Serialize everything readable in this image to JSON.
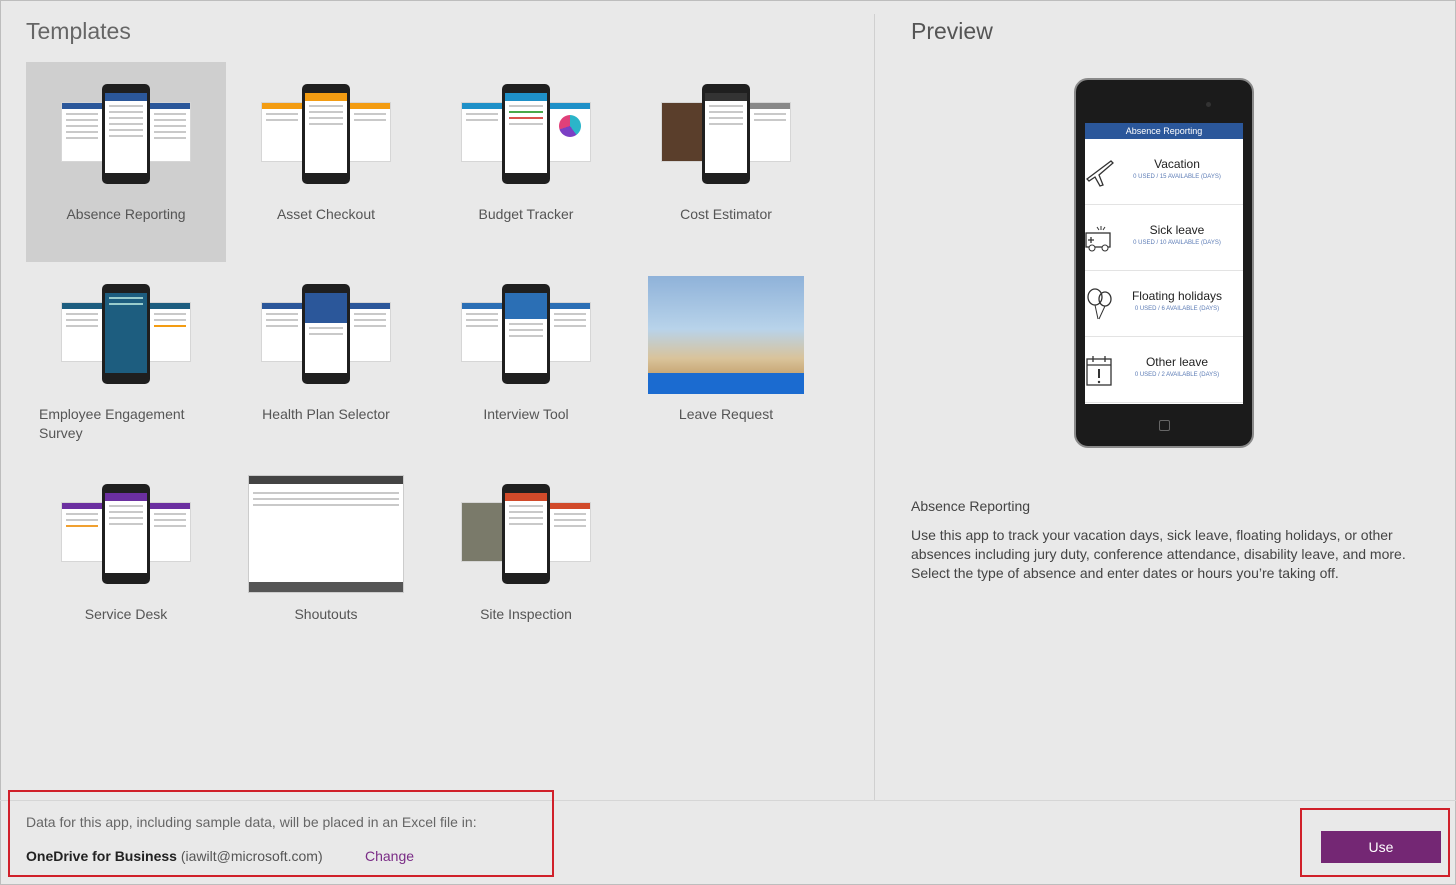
{
  "headings": {
    "templates": "Templates",
    "preview": "Preview"
  },
  "templates": [
    {
      "label": "Absence Reporting",
      "accent": "#2b579a",
      "selected": true
    },
    {
      "label": "Asset Checkout",
      "accent": "#f39c12"
    },
    {
      "label": "Budget Tracker",
      "accent": "#1e90c8"
    },
    {
      "label": "Cost Estimator",
      "accent": "#5a3e2b"
    },
    {
      "label": "Employee Engagement Survey",
      "accent": "#1d5d7f"
    },
    {
      "label": "Health Plan Selector",
      "accent": "#2b579a"
    },
    {
      "label": "Interview Tool",
      "accent": "#2b6fb5"
    },
    {
      "label": "Leave Request",
      "accent": "#1b6bd0"
    },
    {
      "label": "Service Desk",
      "accent": "#6b2fa0"
    },
    {
      "label": "Shoutouts",
      "accent": "#444444"
    },
    {
      "label": "Site Inspection",
      "accent": "#d14a2a"
    }
  ],
  "preview": {
    "screen_title": "Absence Reporting",
    "leaves": [
      {
        "title": "Vacation",
        "sub": "0 USED / 15 AVAILABLE (DAYS)",
        "icon": "airplane-icon"
      },
      {
        "title": "Sick leave",
        "sub": "0 USED / 10 AVAILABLE (DAYS)",
        "icon": "ambulance-icon"
      },
      {
        "title": "Floating holidays",
        "sub": "0 USED / 6 AVAILABLE (DAYS)",
        "icon": "balloons-icon"
      },
      {
        "title": "Other leave",
        "sub": "0 USED / 2 AVAILABLE (DAYS)",
        "icon": "calendar-alert-icon"
      }
    ],
    "title": "Absence Reporting",
    "description": "Use this app to track your vacation days, sick leave, floating holidays, or other absences including jury duty, conference attendance, disability leave, and more. Select the type of absence and enter dates or hours you’re taking off."
  },
  "footer": {
    "note": "Data for this app, including sample data, will be placed in an Excel file in:",
    "location_name": "OneDrive for Business",
    "location_account": "(iawilt@microsoft.com)",
    "change_label": "Change",
    "use_label": "Use"
  },
  "colors": {
    "accent_purple": "#742774",
    "highlight_red": "#d0202a"
  }
}
